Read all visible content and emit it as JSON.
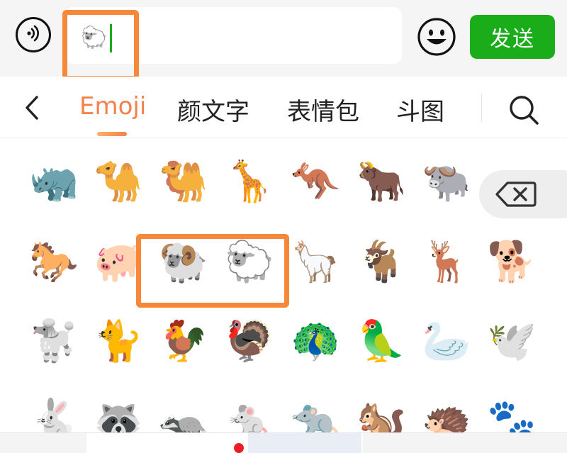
{
  "input": {
    "value": "🐑"
  },
  "send_label": "发送",
  "tabs": [
    {
      "label": "Emoji"
    },
    {
      "label": "颜文字"
    },
    {
      "label": "表情包"
    },
    {
      "label": "斗图"
    }
  ],
  "emoji_rows": [
    [
      "🦏",
      "🐪",
      "🐫",
      "🦒",
      "🦘",
      "🐂",
      "🐃"
    ],
    [
      "🐎",
      "🐖",
      "🐏",
      "🐑",
      "🦙",
      "🐐",
      "🦌",
      "🐕"
    ],
    [
      "🐩",
      "🐈",
      "🐓",
      "🦃",
      "🦚",
      "🦜",
      "🦢",
      "🕊️"
    ],
    [
      "🐇",
      "🦝",
      "🦡",
      "🐁",
      "🐀",
      "🐿️",
      "🦔",
      "🐾"
    ]
  ],
  "colors": {
    "accent": "#f2814a",
    "send_green": "#1aad19",
    "highlight": "#f7883a"
  },
  "icons": {
    "voice": "voice-icon",
    "smile": "smile-icon",
    "back": "chevron-left-icon",
    "search": "search-icon",
    "backspace": "backspace-icon"
  }
}
